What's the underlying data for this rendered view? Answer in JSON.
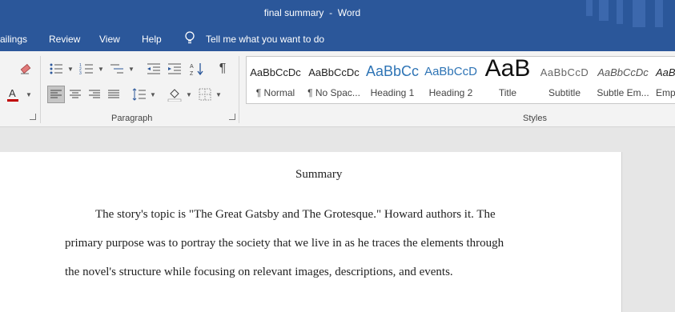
{
  "titlebar": {
    "doc_name": "final summary",
    "separator": "-",
    "app": "Word"
  },
  "tabs": {
    "mailings": "ailings",
    "review": "Review",
    "view": "View",
    "help": "Help",
    "tell_me": "Tell me what you want to do"
  },
  "groups": {
    "paragraph": "Paragraph",
    "styles": "Styles"
  },
  "styles": [
    {
      "preview": "AaBbCcDc",
      "name": "¶ Normal"
    },
    {
      "preview": "AaBbCcDc",
      "name": "¶ No Spac..."
    },
    {
      "preview": "AaBbCc",
      "name": "Heading 1"
    },
    {
      "preview": "AaBbCcD",
      "name": "Heading 2"
    },
    {
      "preview": "AaB",
      "name": "Title"
    },
    {
      "preview": "AaBbCcD",
      "name": "Subtitle"
    },
    {
      "preview": "AaBbCcDc",
      "name": "Subtle Em..."
    },
    {
      "preview": "AaBl",
      "name": "Emp"
    }
  ],
  "document": {
    "heading": "Summary",
    "lines": [
      "The story's topic is \"The Great Gatsby and The Grotesque.\" Howard authors it. The",
      "primary purpose was to portray the society that we live in as he traces the elements through",
      "the novel's structure while focusing on relevant images, descriptions, and events."
    ]
  },
  "colors": {
    "ribbon_blue": "#2b579a",
    "font_color_red": "#c00000"
  },
  "icons": [
    "eraser-icon",
    "bullets-icon",
    "numbering-icon",
    "multilevel-list-icon",
    "decrease-indent-icon",
    "increase-indent-icon",
    "sort-icon",
    "pilcrow-icon",
    "font-color-icon",
    "align-left-icon",
    "center-icon",
    "align-right-icon",
    "justify-icon",
    "line-spacing-icon",
    "shading-icon",
    "borders-icon",
    "lightbulb-icon"
  ]
}
